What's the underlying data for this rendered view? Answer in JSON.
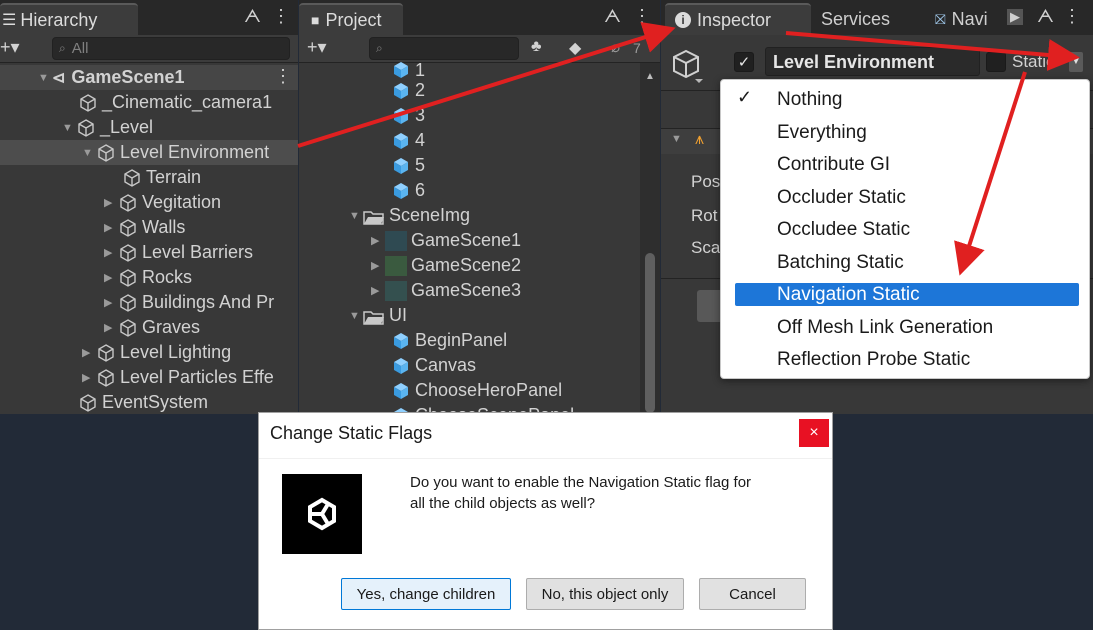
{
  "hierarchy": {
    "tab_label": "Hierarchy",
    "add_label": "+▾",
    "search_placeholder": "All",
    "items": [
      {
        "label": "GameScene1",
        "icon": "unity-scene-icon"
      },
      {
        "label": "_Cinematic_camera1",
        "icon": "gameobject-icon"
      },
      {
        "label": "_Level",
        "icon": "gameobject-icon"
      },
      {
        "label": "Level Environment",
        "icon": "gameobject-icon"
      },
      {
        "label": "Terrain",
        "icon": "gameobject-icon"
      },
      {
        "label": "Vegitation",
        "icon": "gameobject-icon"
      },
      {
        "label": "Walls",
        "icon": "gameobject-icon"
      },
      {
        "label": "Level Barriers",
        "icon": "gameobject-icon"
      },
      {
        "label": "Rocks",
        "icon": "gameobject-icon"
      },
      {
        "label": "Buildings And Pr",
        "icon": "gameobject-icon"
      },
      {
        "label": "Graves",
        "icon": "gameobject-icon"
      },
      {
        "label": "Level Lighting",
        "icon": "gameobject-icon"
      },
      {
        "label": "Level Particles Effe",
        "icon": "gameobject-icon"
      },
      {
        "label": "EventSystem",
        "icon": "gameobject-icon"
      }
    ]
  },
  "project": {
    "tab_label": "Project",
    "add_label": "+▾",
    "hidden_count": "7",
    "items": [
      {
        "label": "1",
        "icon": "prefab-icon"
      },
      {
        "label": "2",
        "icon": "prefab-icon"
      },
      {
        "label": "3",
        "icon": "prefab-icon"
      },
      {
        "label": "4",
        "icon": "prefab-icon"
      },
      {
        "label": "5",
        "icon": "prefab-icon"
      },
      {
        "label": "6",
        "icon": "prefab-icon"
      },
      {
        "label": "SceneImg",
        "icon": "folder-icon"
      },
      {
        "label": "GameScene1",
        "icon": "image-thumbnail-icon"
      },
      {
        "label": "GameScene2",
        "icon": "image-thumbnail-icon"
      },
      {
        "label": "GameScene3",
        "icon": "image-thumbnail-icon"
      },
      {
        "label": "UI",
        "icon": "folder-icon"
      },
      {
        "label": "BeginPanel",
        "icon": "prefab-icon"
      },
      {
        "label": "Canvas",
        "icon": "prefab-icon"
      },
      {
        "label": "ChooseHeroPanel",
        "icon": "prefab-icon"
      },
      {
        "label": "ChooseScenePanel",
        "icon": "prefab-icon"
      }
    ]
  },
  "inspector": {
    "tabs": [
      {
        "label": "Inspector",
        "icon": "info-icon"
      },
      {
        "label": "Services"
      },
      {
        "label": "Navi",
        "icon": "navigation-icon"
      }
    ],
    "object_name": "Level Environment",
    "static_label": "Static",
    "transform_fields": [
      "Pos",
      "Rot",
      "Sca"
    ]
  },
  "static_dropdown": {
    "items": [
      "Nothing",
      "Everything",
      "Contribute GI",
      "Occluder Static",
      "Occludee Static",
      "Batching Static",
      "Navigation Static",
      "Off Mesh Link Generation",
      "Reflection Probe Static"
    ],
    "checked": "Nothing",
    "highlighted": "Navigation Static"
  },
  "dialog": {
    "title": "Change Static Flags",
    "close_label": "×",
    "message_line1": "Do you want to enable the Navigation Static flag for",
    "message_line2": "all the child objects as well?",
    "buttons": [
      "Yes, change children",
      "No, this object only",
      "Cancel"
    ]
  },
  "colors": {
    "panel_bg": "#383838",
    "selection_blue": "#1d76d8",
    "annotation_red": "#e02020",
    "prefab_blue": "#4aa8e8",
    "desktop_bg": "#222a37"
  }
}
